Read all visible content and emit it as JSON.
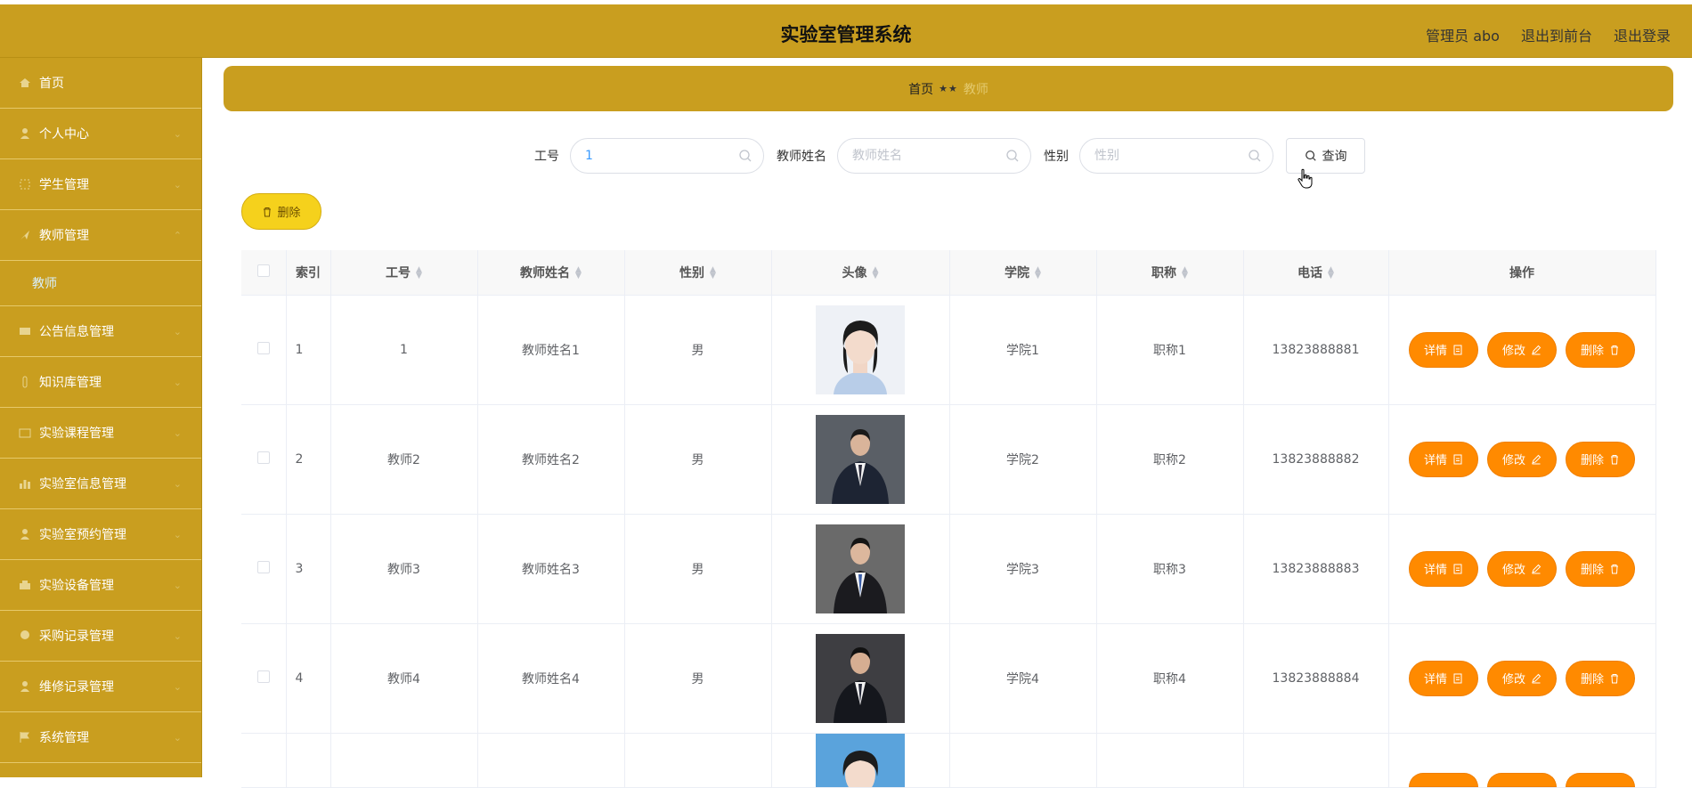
{
  "header": {
    "title": "实验室管理系统",
    "user": "管理员 abo",
    "back_to_front": "退出到前台",
    "logout": "退出登录"
  },
  "sidebar": {
    "items": [
      {
        "label": "首页",
        "icon": "home-icon"
      },
      {
        "label": "个人中心",
        "icon": "user-icon"
      },
      {
        "label": "学生管理",
        "icon": "student-icon"
      },
      {
        "label": "教师管理",
        "icon": "teacher-icon"
      },
      {
        "label": "公告信息管理",
        "icon": "notice-icon"
      },
      {
        "label": "知识库管理",
        "icon": "knowledge-icon"
      },
      {
        "label": "实验课程管理",
        "icon": "course-icon"
      },
      {
        "label": "实验室信息管理",
        "icon": "chart-icon"
      },
      {
        "label": "实验室预约管理",
        "icon": "reservation-icon"
      },
      {
        "label": "实验设备管理",
        "icon": "equipment-icon"
      },
      {
        "label": "采购记录管理",
        "icon": "purchase-icon"
      },
      {
        "label": "维修记录管理",
        "icon": "repair-icon"
      },
      {
        "label": "系统管理",
        "icon": "flag-icon"
      }
    ],
    "sub_active": "教师"
  },
  "breadcrumb": {
    "home": "首页",
    "separator": "★★",
    "current": "教师"
  },
  "search": {
    "id_label": "工号",
    "id_value": "1",
    "name_label": "教师姓名",
    "name_placeholder": "教师姓名",
    "gender_label": "性别",
    "gender_placeholder": "性别",
    "query_button": "查询"
  },
  "batch_delete_label": "删除",
  "table": {
    "headers": {
      "index": "索引",
      "id": "工号",
      "name": "教师姓名",
      "gender": "性别",
      "avatar": "头像",
      "college": "学院",
      "title": "职称",
      "phone": "电话",
      "actions": "操作"
    },
    "rows": [
      {
        "index": "1",
        "id": "1",
        "name": "教师姓名1",
        "gender": "男",
        "college": "学院1",
        "title": "职称1",
        "phone": "13823888881",
        "avatar": "female-photo"
      },
      {
        "index": "2",
        "id": "教师2",
        "name": "教师姓名2",
        "gender": "男",
        "college": "学院2",
        "title": "职称2",
        "phone": "13823888882",
        "avatar": "male-photo"
      },
      {
        "index": "3",
        "id": "教师3",
        "name": "教师姓名3",
        "gender": "男",
        "college": "学院3",
        "title": "职称3",
        "phone": "13823888883",
        "avatar": "male-photo"
      },
      {
        "index": "4",
        "id": "教师4",
        "name": "教师姓名4",
        "gender": "男",
        "college": "学院4",
        "title": "职称4",
        "phone": "13823888884",
        "avatar": "male-photo"
      }
    ],
    "actions": {
      "detail": "详情",
      "edit": "修改",
      "delete": "删除"
    }
  },
  "colors": {
    "header_bg": "#c99e1f",
    "button_orange": "#ff8a00",
    "batch_delete_bg": "#f5d11c"
  }
}
